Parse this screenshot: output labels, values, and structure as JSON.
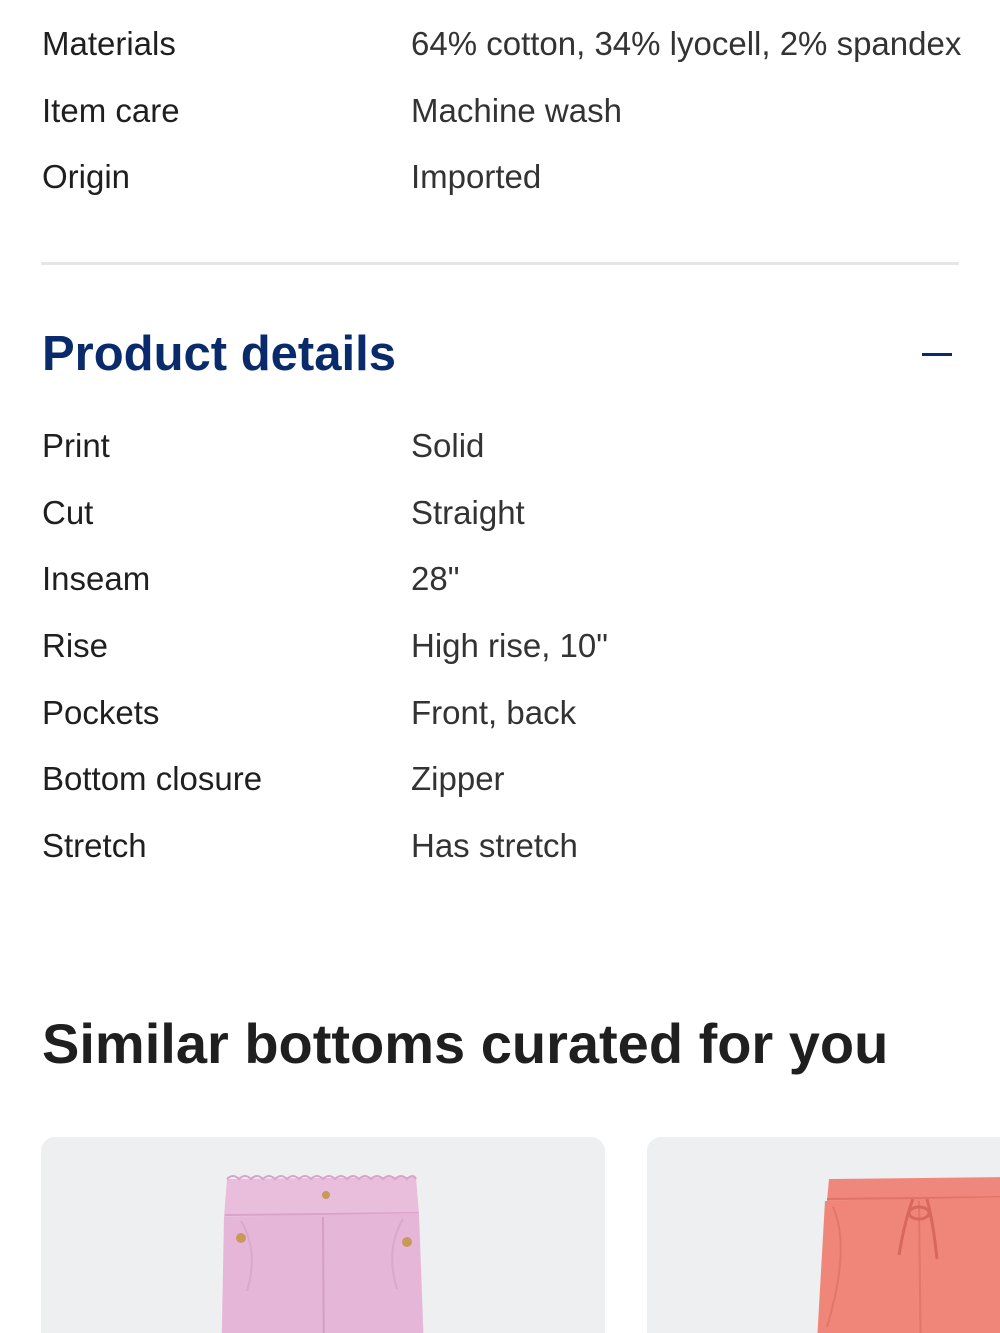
{
  "specs": [
    {
      "label": "Materials",
      "value": "64% cotton, 34% lyocell, 2% spandex"
    },
    {
      "label": "Item care",
      "value": "Machine wash"
    },
    {
      "label": "Origin",
      "value": "Imported"
    }
  ],
  "product_details": {
    "title": "Product details",
    "toggle_icon": "minus-icon",
    "rows": [
      {
        "label": "Print",
        "value": "Solid"
      },
      {
        "label": "Cut",
        "value": "Straight"
      },
      {
        "label": "Inseam",
        "value": "28\""
      },
      {
        "label": "Rise",
        "value": "High rise, 10\""
      },
      {
        "label": "Pockets",
        "value": "Front, back"
      },
      {
        "label": "Bottom closure",
        "value": "Zipper"
      },
      {
        "label": "Stretch",
        "value": "Has stretch"
      }
    ]
  },
  "similar": {
    "title": "Similar bottoms curated for you",
    "products": [
      {
        "image": "pink-paperbag-pants-image",
        "color": "#e9bddc"
      },
      {
        "image": "coral-drawstring-pants-image",
        "color": "#f0877c"
      }
    ]
  },
  "colors": {
    "accent": "#0a2b6b",
    "card_bg": "#eeeff1",
    "divider": "#e6e6e6"
  }
}
